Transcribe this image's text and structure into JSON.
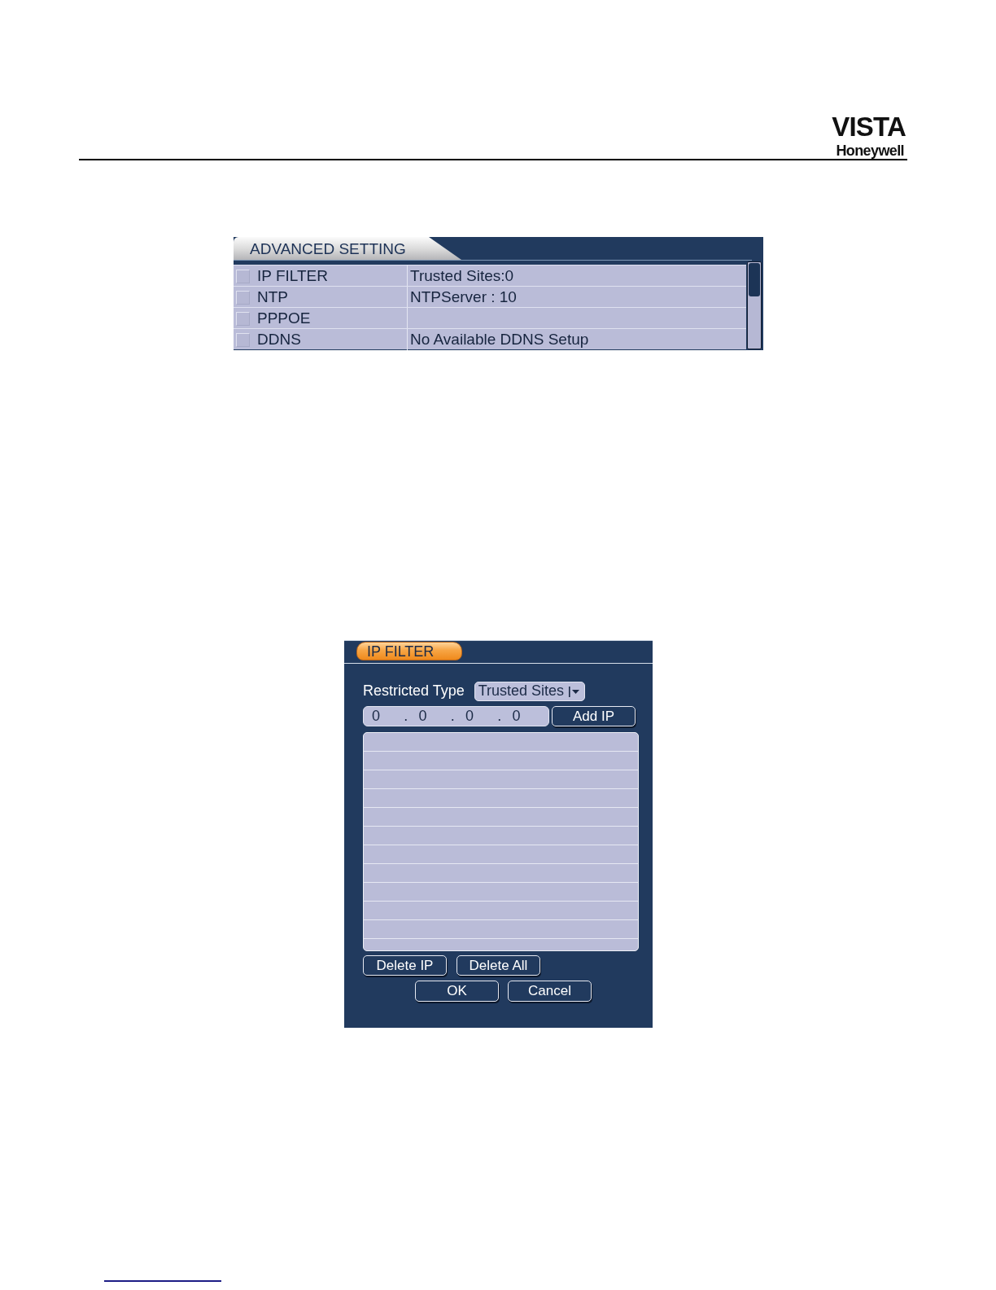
{
  "header": {
    "logo_title": "VISTA",
    "logo_subtitle": "Honeywell"
  },
  "advanced_setting": {
    "title": "ADVANCED SETTING",
    "rows": [
      {
        "checked": false,
        "name": "IP FILTER",
        "value": "Trusted Sites:0"
      },
      {
        "checked": false,
        "name": "NTP",
        "value": "NTPServer : 10"
      },
      {
        "checked": false,
        "name": "PPPOE"
      },
      {
        "checked": false,
        "name": "DDNS",
        "value": "No Available DDNS Setup"
      }
    ]
  },
  "ip_filter": {
    "title": "IP FILTER",
    "restricted_type": {
      "label": "Restricted Type",
      "value": "Trusted Sites"
    },
    "ip_address": {
      "octets": [
        "0",
        "0",
        "0",
        "0"
      ],
      "separators": [
        ".",
        ".",
        "."
      ]
    },
    "add_button": "Add IP",
    "list_buttons": [
      "Delete IP",
      "Delete All"
    ],
    "dialog_buttons": [
      "OK",
      "Cancel"
    ]
  }
}
